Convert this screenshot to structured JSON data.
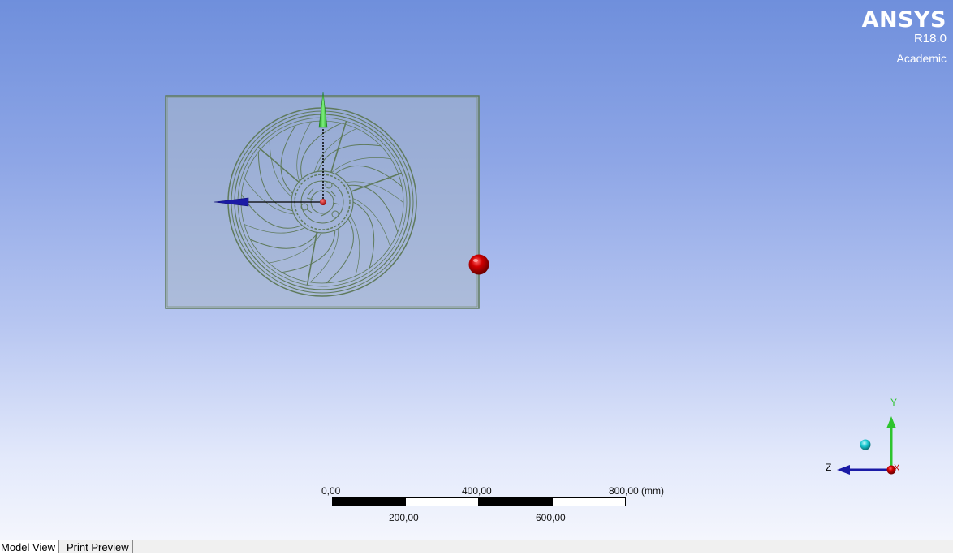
{
  "brand": {
    "name": "ANSYS",
    "version": "R18.0",
    "edition": "Academic"
  },
  "scale_bar": {
    "labels_top": [
      "0,00",
      "400,00",
      "800,00 (mm)"
    ],
    "labels_bottom": [
      "200,00",
      "600,00"
    ]
  },
  "triad": {
    "x_label": "X",
    "y_label": "Y",
    "z_label": "Z"
  },
  "tabs": [
    {
      "label": "Model View",
      "active": true
    },
    {
      "label": "Print Preview",
      "active": false
    }
  ],
  "colors": {
    "axis_y": "#2ec42e",
    "axis_z": "#1a1aa6",
    "point_marker": "#c00000",
    "triad_iso": "#19c8d0",
    "geometry_edge": "#5f7a5c"
  }
}
